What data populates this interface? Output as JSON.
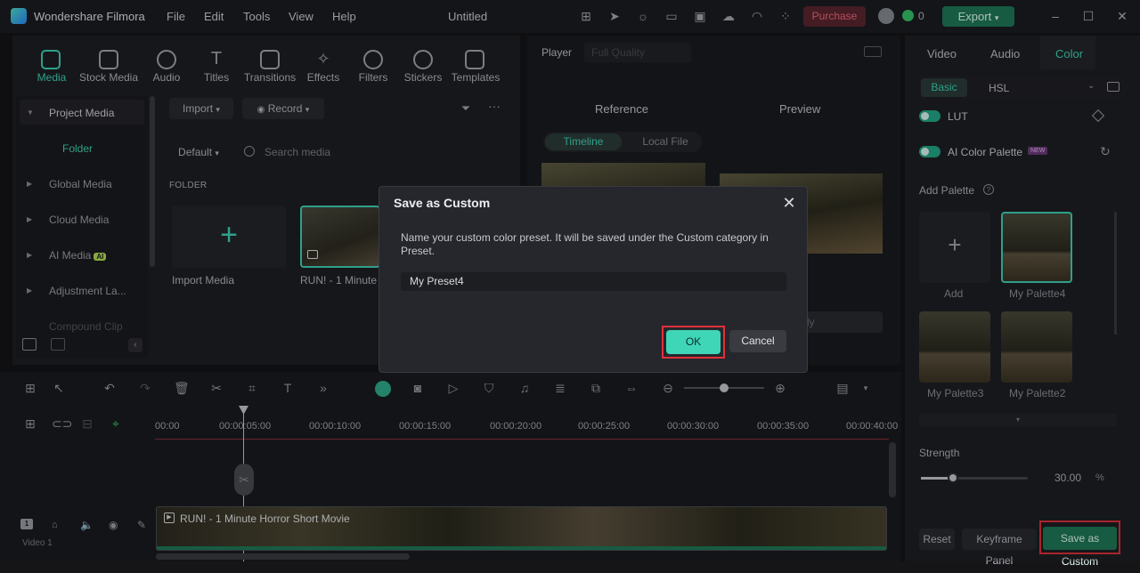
{
  "app": {
    "name": "Wondershare Filmora",
    "doc_title": "Untitled"
  },
  "menu": [
    "File",
    "Edit",
    "Tools",
    "View",
    "Help"
  ],
  "top_right": {
    "purchase": "Purchase",
    "credits": "0",
    "export": "Export"
  },
  "media_tabs": [
    "Media",
    "Stock Media",
    "Audio",
    "Titles",
    "Transitions",
    "Effects",
    "Filters",
    "Stickers",
    "Templates"
  ],
  "sidebar": {
    "project_media": "Project Media",
    "folder": "Folder",
    "items": [
      "Global Media",
      "Cloud Media",
      "AI Media",
      "Adjustment La...",
      "Compound Clip"
    ],
    "ai_badge": "AI"
  },
  "media_toolbar": {
    "import": "Import",
    "record": "Record",
    "sort": "Default",
    "search_placeholder": "Search media"
  },
  "folder_label": "FOLDER",
  "tiles": {
    "import": "Import Media",
    "clip": "RUN! - 1 Minute"
  },
  "player": {
    "label": "Player",
    "quality": "Full Quality",
    "reference": "Reference",
    "preview": "Preview",
    "tab_timeline": "Timeline",
    "tab_local": "Local File",
    "apply": "Apply"
  },
  "right_panel": {
    "tabs": [
      "Video",
      "Audio",
      "Color"
    ],
    "subtabs": [
      "Basic",
      "HSL"
    ],
    "lut": "LUT",
    "ai_palette": "AI Color Palette",
    "new_badge": "NEW",
    "add_palette": "Add Palette",
    "add": "Add",
    "palettes": [
      "My Palette4",
      "My Palette3",
      "My Palette2"
    ],
    "strength_label": "Strength",
    "strength_value": "30.00",
    "strength_unit": "%",
    "strength_fraction": 0.3,
    "reset": "Reset",
    "keyframe": "Keyframe Panel",
    "save_custom": "Save as Custom"
  },
  "timeline": {
    "ticks": [
      "00:00",
      "00:00:05:00",
      "00:00:10:00",
      "00:00:15:00",
      "00:00:20:00",
      "00:00:25:00",
      "00:00:30:00",
      "00:00:35:00",
      "00:00:40:00"
    ],
    "clip_name": "RUN! - 1 Minute Horror Short Movie",
    "track": "Video 1",
    "track_number": "1"
  },
  "dialog": {
    "title": "Save as Custom",
    "message": "Name your custom color preset. It will be saved under the Custom category in Preset.",
    "input_value": "My Preset4",
    "ok": "OK",
    "cancel": "Cancel"
  }
}
